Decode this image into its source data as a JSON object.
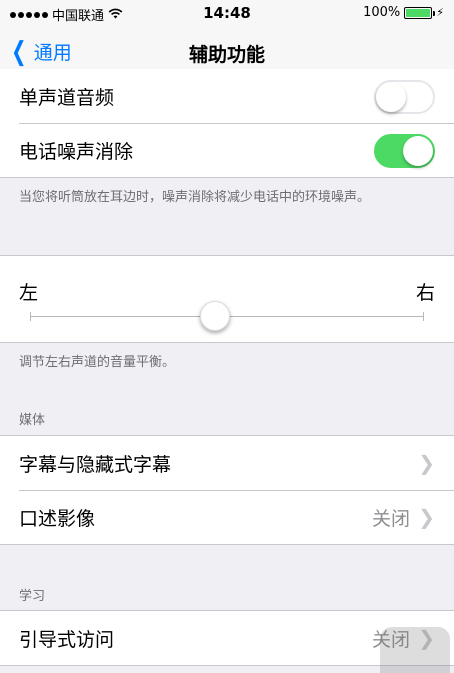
{
  "status_bar": {
    "carrier": "中国联通",
    "time": "14:48",
    "battery_percent": "100%",
    "battery_level": 1.0
  },
  "nav": {
    "back_label": "通用",
    "title": "辅助功能"
  },
  "audio_group": {
    "mono_audio_label": "单声道音频",
    "mono_audio_on": false,
    "phone_noise_label": "电话噪声消除",
    "phone_noise_on": true
  },
  "noise_footnote": "当您将听筒放在耳边时，噪声消除将减少电话中的环境噪声。",
  "balance": {
    "left_label": "左",
    "right_label": "右",
    "value": 0.47,
    "footnote": "调节左右声道的音量平衡。"
  },
  "media_section": {
    "header": "媒体",
    "subtitles_label": "字幕与隐藏式字幕",
    "audio_desc_label": "口述影像",
    "audio_desc_value": "关闭"
  },
  "learning_section": {
    "header": "学习",
    "guided_access_label": "引导式访问",
    "guided_access_value": "关闭"
  },
  "colors": {
    "accent": "#007aff",
    "toggle_on": "#4cd964",
    "background": "#efeff4"
  },
  "icons": {
    "back": "chevron-left-icon",
    "disclosure": "chevron-right-icon",
    "wifi": "wifi-icon",
    "battery": "battery-icon",
    "charging": "bolt-icon"
  }
}
